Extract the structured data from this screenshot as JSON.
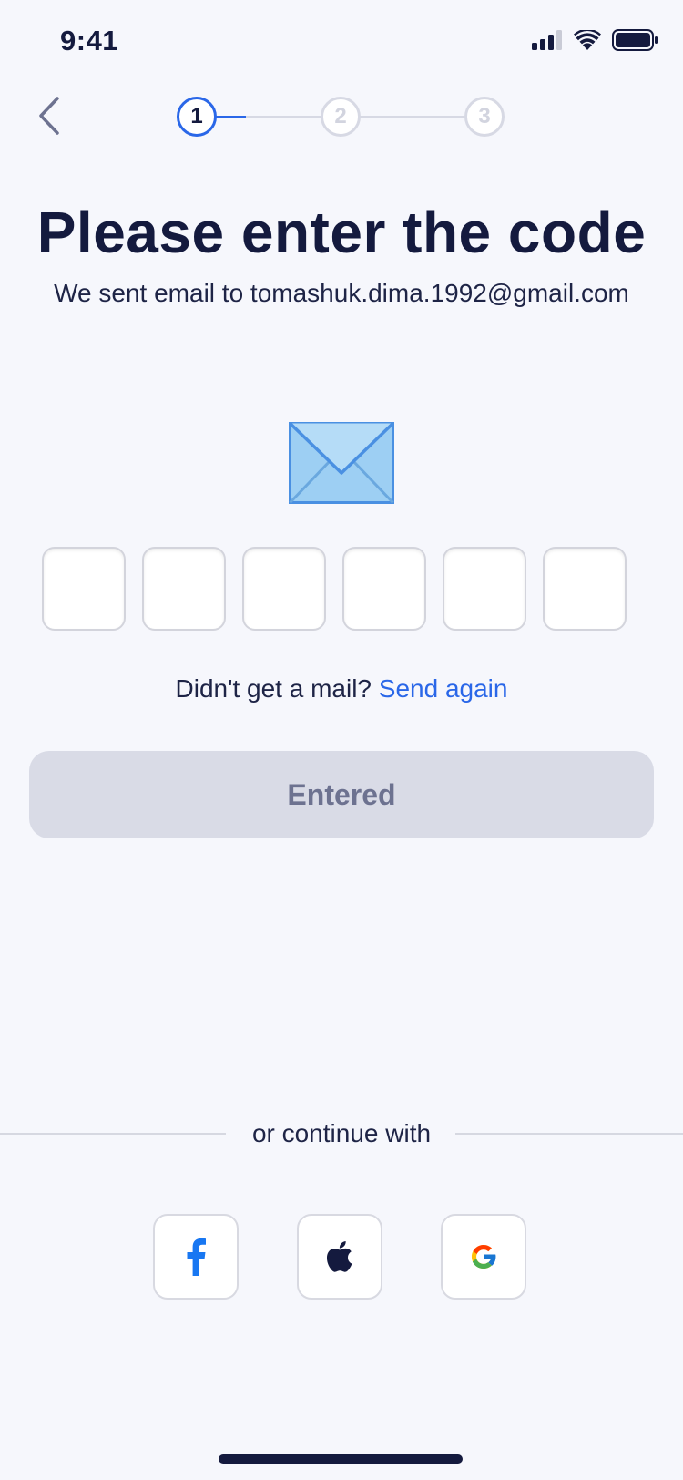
{
  "status_bar": {
    "time": "9:41"
  },
  "stepper": {
    "steps": [
      "1",
      "2",
      "3"
    ],
    "active_step": 1
  },
  "header": {
    "title": "Please enter the code",
    "subtitle": "We sent email to tomashuk.dima.1992@gmail.com"
  },
  "otp": {
    "length": 6,
    "values": [
      "",
      "",
      "",
      "",
      "",
      ""
    ]
  },
  "resend": {
    "prompt": "Didn't get a mail?",
    "link": "Send again"
  },
  "primary_button": {
    "label": "Entered",
    "enabled": false
  },
  "divider": {
    "text": "or continue with"
  },
  "social_buttons": [
    {
      "name": "facebook-icon",
      "color": "#1877f2"
    },
    {
      "name": "apple-icon",
      "color": "#141a3e"
    },
    {
      "name": "google-icon",
      "color": "#4285f4"
    }
  ],
  "colors": {
    "background": "#f6f7fc",
    "primary_text": "#141a3e",
    "accent": "#2a67e8",
    "disabled_button_bg": "#d9dbe6",
    "disabled_button_text": "#6d7290"
  }
}
